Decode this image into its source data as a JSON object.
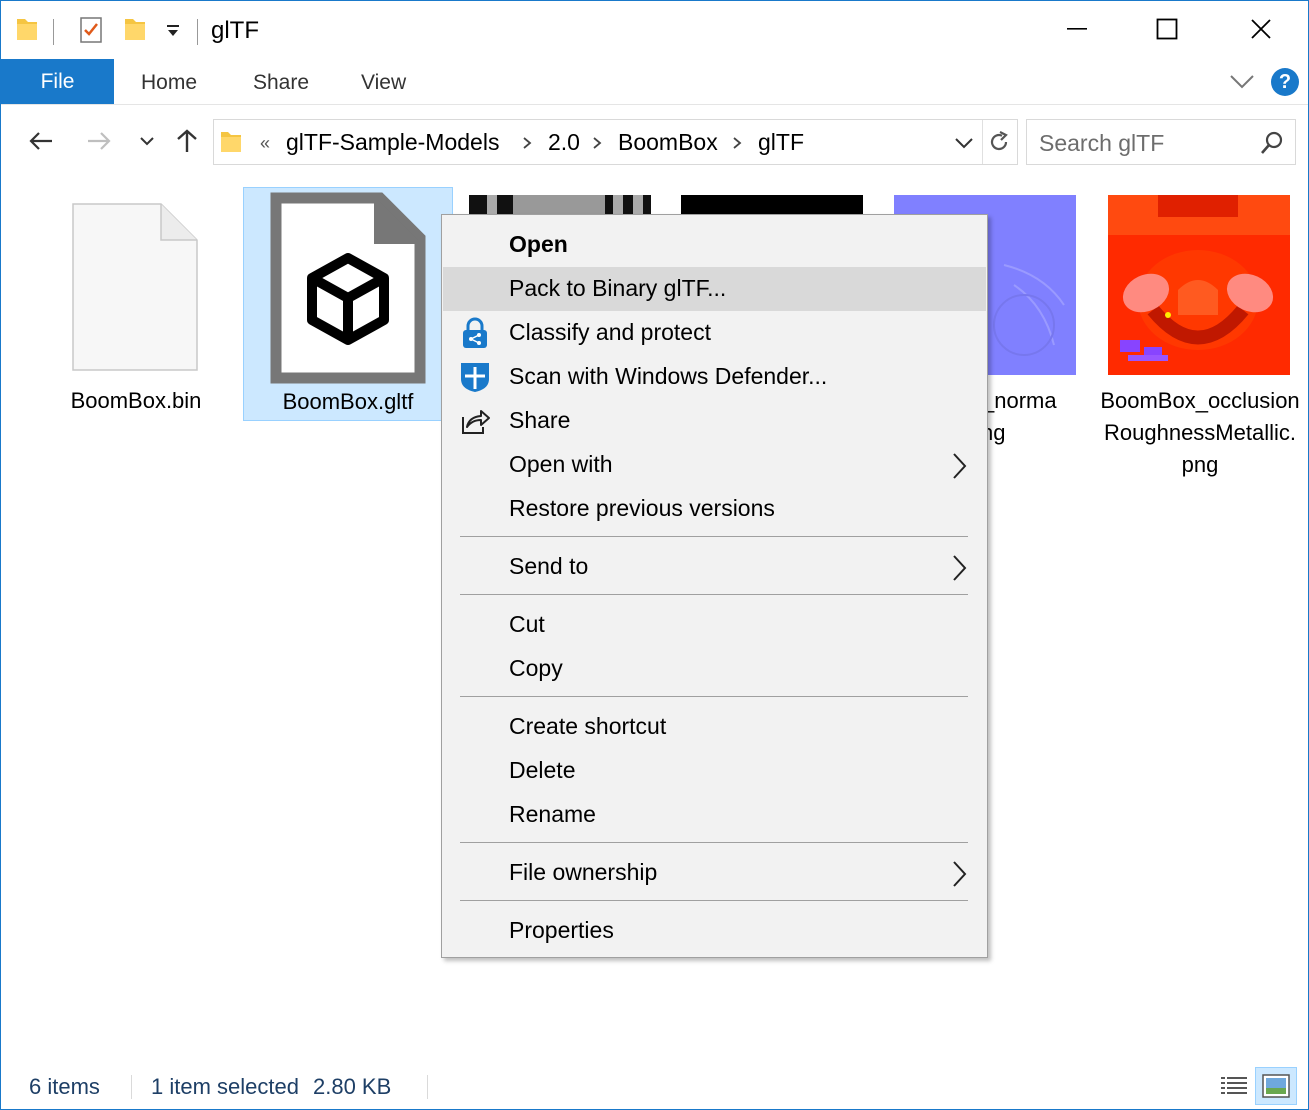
{
  "window": {
    "title": "glTF"
  },
  "ribbon": {
    "tabs": [
      {
        "label": "File"
      },
      {
        "label": "Home"
      },
      {
        "label": "Share"
      },
      {
        "label": "View"
      }
    ],
    "help_label": "?"
  },
  "address": {
    "overflow_label": "«",
    "crumbs": [
      "glTF-Sample-Models",
      "2.0",
      "BoomBox",
      "glTF"
    ]
  },
  "search": {
    "placeholder": "Search glTF"
  },
  "files": [
    {
      "name": "BoomBox.bin",
      "icon": "blank-file-icon"
    },
    {
      "name": "BoomBox.gltf",
      "icon": "gltf-cube-file-icon",
      "selected": true
    },
    {
      "name": "",
      "icon": "texture-thumbnail"
    },
    {
      "name": "",
      "icon": "texture-thumbnail"
    },
    {
      "name_line1": "x_norma",
      "name_line2": "ng",
      "icon": "normal-map-thumbnail"
    },
    {
      "name": "BoomBox_occlusionRoughnessMetallic.png",
      "icon": "orm-texture-thumbnail"
    }
  ],
  "context_menu": {
    "items": [
      {
        "label": "Open",
        "bold": true
      },
      {
        "label": "Pack to Binary glTF...",
        "hover": true
      },
      {
        "label": "Classify and protect",
        "icon": "lock-share-icon"
      },
      {
        "label": "Scan with Windows Defender...",
        "icon": "defender-shield-icon"
      },
      {
        "label": "Share",
        "icon": "share-icon"
      },
      {
        "label": "Open with",
        "submenu": true
      },
      {
        "label": "Restore previous versions"
      },
      {
        "label": "Send to",
        "submenu": true
      },
      {
        "label": "Cut"
      },
      {
        "label": "Copy"
      },
      {
        "label": "Create shortcut"
      },
      {
        "label": "Delete"
      },
      {
        "label": "Rename"
      },
      {
        "label": "File ownership",
        "submenu": true
      },
      {
        "label": "Properties"
      }
    ]
  },
  "status": {
    "item_count": "6 items",
    "selection": "1 item selected",
    "size": "2.80 KB"
  },
  "colors": {
    "accent": "#1979ca",
    "selection_bg": "#cce8ff",
    "menu_bg": "#f2f2f2",
    "menu_hover": "#d9d9d9"
  }
}
